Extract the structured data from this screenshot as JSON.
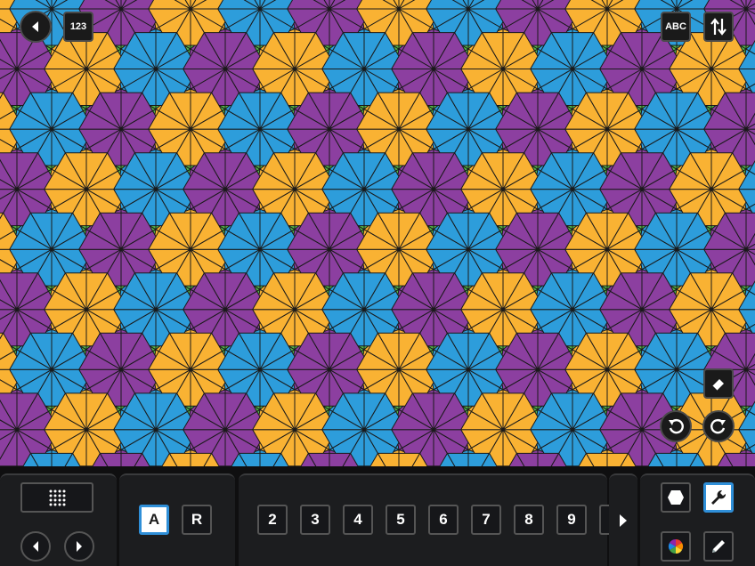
{
  "top_bar": {
    "back_icon": "chevron-left-icon",
    "numbers_label": "123",
    "letters_label": "ABC",
    "swap_icon": "swap-vertical-icon"
  },
  "canvas": {
    "palette": [
      "#f9b233",
      "#54b848",
      "#2d9ddb",
      "#8c3fa0"
    ],
    "edge_color": "#1a1a1a",
    "eraser_icon": "eraser-icon",
    "undo_icon": "undo-icon",
    "redo_icon": "redo-icon"
  },
  "toolbar": {
    "grid_icon": "dot-grid-icon",
    "prev_icon": "chevron-left-icon",
    "next_icon": "chevron-right-icon",
    "mode_keys": [
      "A",
      "R"
    ],
    "selected_mode": "A",
    "number_keys": [
      "2",
      "3",
      "4",
      "5",
      "6",
      "7",
      "8",
      "9"
    ],
    "more_icon": "chevron-right-icon",
    "shape_icon": "hexagon-icon",
    "wrench_icon": "wrench-icon",
    "color_icon": "color-wheel-icon",
    "pencil_icon": "pencil-icon"
  }
}
